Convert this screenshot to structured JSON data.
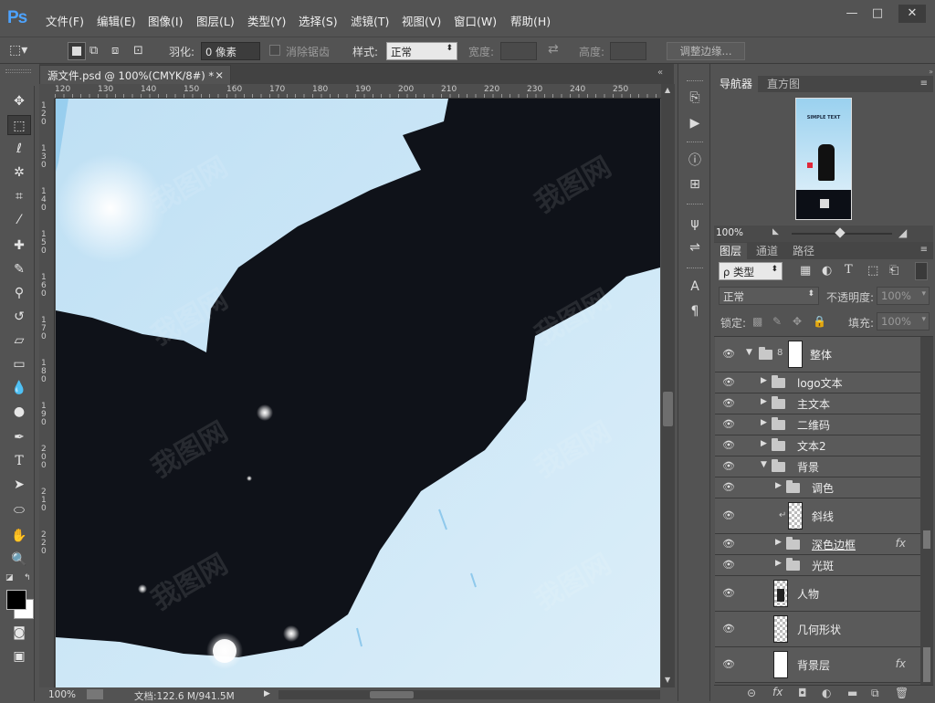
{
  "app": {
    "logo": "Ps"
  },
  "menu": [
    "文件(F)",
    "编辑(E)",
    "图像(I)",
    "图层(L)",
    "类型(Y)",
    "选择(S)",
    "滤镜(T)",
    "视图(V)",
    "窗口(W)",
    "帮助(H)"
  ],
  "window_controls": {
    "minimize": "—",
    "maximize": "□",
    "close": "✕"
  },
  "options": {
    "feather_label": "羽化:",
    "feather_value": "0 像素",
    "antialias_label": "消除锯齿",
    "style_label": "样式:",
    "style_value": "正常",
    "width_label": "宽度:",
    "height_label": "高度:",
    "refine_button": "调整边缘..."
  },
  "document": {
    "tab_title": "源文件.psd @ 100%(CMYK/8#) *",
    "close": "×",
    "ruler_h": [
      "120",
      "130",
      "140",
      "150",
      "160",
      "170",
      "180",
      "190",
      "200",
      "210",
      "220",
      "230",
      "240",
      "250"
    ],
    "ruler_v": [
      "1",
      "2",
      "0",
      "1",
      "3",
      "0",
      "1",
      "4",
      "0",
      "1",
      "5",
      "0",
      "1",
      "6",
      "0",
      "1",
      "7",
      "0",
      "1",
      "8",
      "0",
      "1",
      "9",
      "0",
      "2",
      "0",
      "0",
      "2",
      "1",
      "0",
      "2",
      "2",
      "0"
    ]
  },
  "status": {
    "zoom": "100%",
    "doc_info": "文档:122.6 M/941.5M"
  },
  "navigator": {
    "tabs": [
      "导航器",
      "直方图"
    ],
    "zoom": "100%",
    "thumb_text": "SIMPLE TEXT"
  },
  "layers_panel": {
    "tabs": [
      "图层",
      "通道",
      "路径"
    ],
    "filter_label": "ρ 类型",
    "blend_mode": "正常",
    "opacity_label": "不透明度:",
    "opacity_value": "100%",
    "lock_label": "锁定:",
    "fill_label": "填充:",
    "fill_value": "100%",
    "layers": [
      {
        "name": "整体"
      },
      {
        "name": "logo文本"
      },
      {
        "name": "主文本"
      },
      {
        "name": "二维码"
      },
      {
        "name": "文本2"
      },
      {
        "name": "背景"
      },
      {
        "name": "调色"
      },
      {
        "name": "斜线"
      },
      {
        "name": "深色边框"
      },
      {
        "name": "光斑"
      },
      {
        "name": "人物"
      },
      {
        "name": "几何形状"
      },
      {
        "name": "背景层"
      }
    ],
    "fx": "fx"
  },
  "watermark": "我图网",
  "colors": {
    "accent": "#4da3ff",
    "ui_bg": "#535353",
    "canvas_dark": "#0f1219",
    "sky": "#cfe6f5"
  }
}
